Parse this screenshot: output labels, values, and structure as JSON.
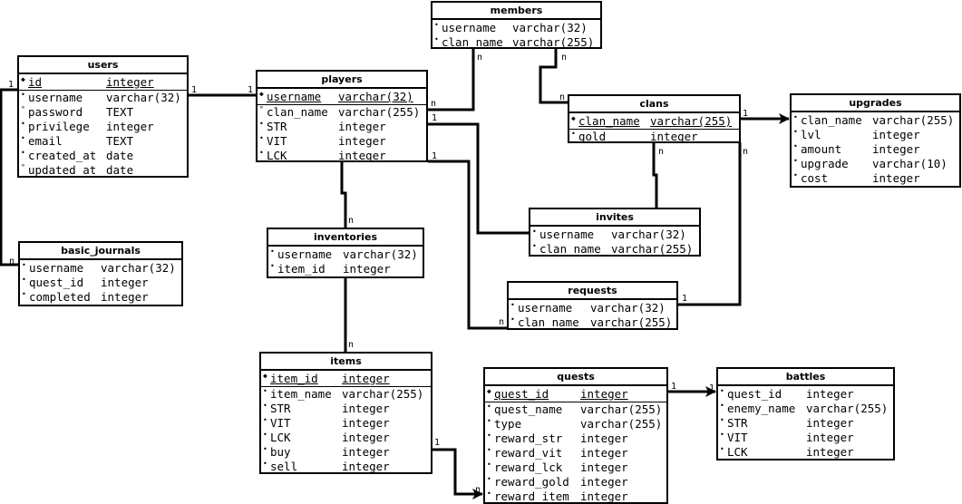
{
  "tables": {
    "members": {
      "title": "members",
      "columns": [
        {
          "name": "username",
          "type": "varchar(32)",
          "marker": "notnull"
        },
        {
          "name": "clan_name",
          "type": "varchar(255)",
          "marker": "notnull"
        }
      ]
    },
    "users": {
      "title": "users",
      "columns": [
        {
          "name": "id",
          "type": "integer",
          "marker": "pk"
        },
        {
          "name": "username",
          "type": "varchar(32)",
          "marker": "notnull"
        },
        {
          "name": "password",
          "type": "TEXT",
          "marker": "nullable"
        },
        {
          "name": "privilege",
          "type": "integer",
          "marker": "notnull"
        },
        {
          "name": "email",
          "type": "TEXT",
          "marker": "notnull"
        },
        {
          "name": "created_at",
          "type": "date",
          "marker": "notnull"
        },
        {
          "name": "updated_at",
          "type": "date",
          "marker": "nullable"
        }
      ]
    },
    "players": {
      "title": "players",
      "columns": [
        {
          "name": "username",
          "type": "varchar(32)",
          "marker": "pk"
        },
        {
          "name": "clan_name",
          "type": "varchar(255)",
          "marker": "nullable"
        },
        {
          "name": "STR",
          "type": "integer",
          "marker": "notnull"
        },
        {
          "name": "VIT",
          "type": "integer",
          "marker": "notnull"
        },
        {
          "name": "LCK",
          "type": "integer",
          "marker": "notnull"
        }
      ]
    },
    "clans": {
      "title": "clans",
      "columns": [
        {
          "name": "clan_name",
          "type": "varchar(255)",
          "marker": "pk"
        },
        {
          "name": "gold",
          "type": "integer",
          "marker": "notnull"
        }
      ]
    },
    "upgrades": {
      "title": "upgrades",
      "columns": [
        {
          "name": "clan_name",
          "type": "varchar(255)",
          "marker": "notnull"
        },
        {
          "name": "lvl",
          "type": "integer",
          "marker": "notnull"
        },
        {
          "name": "amount",
          "type": "integer",
          "marker": "notnull"
        },
        {
          "name": "upgrade",
          "type": "varchar(10)",
          "marker": "notnull"
        },
        {
          "name": "cost",
          "type": "integer",
          "marker": "notnull"
        }
      ]
    },
    "invites": {
      "title": "invites",
      "columns": [
        {
          "name": "username",
          "type": "varchar(32)",
          "marker": "notnull"
        },
        {
          "name": "clan_name",
          "type": "varchar(255)",
          "marker": "notnull"
        }
      ]
    },
    "basic_journals": {
      "title": "basic_journals",
      "columns": [
        {
          "name": "username",
          "type": "varchar(32)",
          "marker": "notnull"
        },
        {
          "name": "quest_id",
          "type": "integer",
          "marker": "notnull"
        },
        {
          "name": "completed",
          "type": "integer",
          "marker": "notnull"
        }
      ]
    },
    "inventories": {
      "title": "inventories",
      "columns": [
        {
          "name": "username",
          "type": "varchar(32)",
          "marker": "notnull"
        },
        {
          "name": "item_id",
          "type": "integer",
          "marker": "notnull"
        }
      ]
    },
    "requests": {
      "title": "requests",
      "columns": [
        {
          "name": "username",
          "type": "varchar(32)",
          "marker": "notnull"
        },
        {
          "name": "clan_name",
          "type": "varchar(255)",
          "marker": "notnull"
        }
      ]
    },
    "items": {
      "title": "items",
      "columns": [
        {
          "name": "item_id",
          "type": "integer",
          "marker": "pk"
        },
        {
          "name": "item_name",
          "type": "varchar(255)",
          "marker": "notnull"
        },
        {
          "name": "STR",
          "type": "integer",
          "marker": "notnull"
        },
        {
          "name": "VIT",
          "type": "integer",
          "marker": "notnull"
        },
        {
          "name": "LCK",
          "type": "integer",
          "marker": "notnull"
        },
        {
          "name": "buy",
          "type": "integer",
          "marker": "notnull"
        },
        {
          "name": "sell",
          "type": "integer",
          "marker": "notnull"
        }
      ]
    },
    "quests": {
      "title": "quests",
      "columns": [
        {
          "name": "quest_id",
          "type": "integer",
          "marker": "pk"
        },
        {
          "name": "quest_name",
          "type": "varchar(255)",
          "marker": "notnull"
        },
        {
          "name": "type",
          "type": "varchar(255)",
          "marker": "notnull"
        },
        {
          "name": "reward_str",
          "type": "integer",
          "marker": "notnull"
        },
        {
          "name": "reward_vit",
          "type": "integer",
          "marker": "notnull"
        },
        {
          "name": "reward_lck",
          "type": "integer",
          "marker": "notnull"
        },
        {
          "name": "reward_gold",
          "type": "integer",
          "marker": "notnull"
        },
        {
          "name": "reward_item",
          "type": "integer",
          "marker": "notnull"
        }
      ]
    },
    "battles": {
      "title": "battles",
      "columns": [
        {
          "name": "quest_id",
          "type": "integer",
          "marker": "notnull"
        },
        {
          "name": "enemy_name",
          "type": "varchar(255)",
          "marker": "notnull"
        },
        {
          "name": "STR",
          "type": "integer",
          "marker": "notnull"
        },
        {
          "name": "VIT",
          "type": "integer",
          "marker": "notnull"
        },
        {
          "name": "LCK",
          "type": "integer",
          "marker": "notnull"
        }
      ]
    }
  },
  "relationships": [
    {
      "from": "users",
      "to": "players",
      "from_card": "1",
      "to_card": "1"
    },
    {
      "from": "users",
      "to": "basic_journals",
      "from_card": "1",
      "to_card": "n"
    },
    {
      "from": "players",
      "to": "members",
      "from_card": "n",
      "to_card": "n"
    },
    {
      "from": "members",
      "to": "clans",
      "from_card": "n",
      "to_card": "n"
    },
    {
      "from": "players",
      "to": "invites",
      "from_card": "1",
      "to_card": "n"
    },
    {
      "from": "players",
      "to": "requests",
      "from_card": "1",
      "to_card": "n"
    },
    {
      "from": "clans",
      "to": "upgrades",
      "from_card": "1",
      "to_card": "n"
    },
    {
      "from": "clans",
      "to": "invites",
      "from_card": "n",
      "to_card": "1"
    },
    {
      "from": "clans",
      "to": "requests",
      "from_card": "n",
      "to_card": "1"
    },
    {
      "from": "players",
      "to": "inventories",
      "from_card": "",
      "to_card": "n"
    },
    {
      "from": "inventories",
      "to": "items",
      "from_card": "",
      "to_card": "n"
    },
    {
      "from": "items",
      "to": "quests",
      "from_card": "1",
      "to_card": "n"
    },
    {
      "from": "quests",
      "to": "battles",
      "from_card": "1",
      "to_card": "1"
    }
  ],
  "marker_glyphs": {
    "pk": "◆",
    "notnull": "•",
    "nullable": "°"
  },
  "colors": {
    "line": "#000000",
    "background": "#ffffff"
  }
}
